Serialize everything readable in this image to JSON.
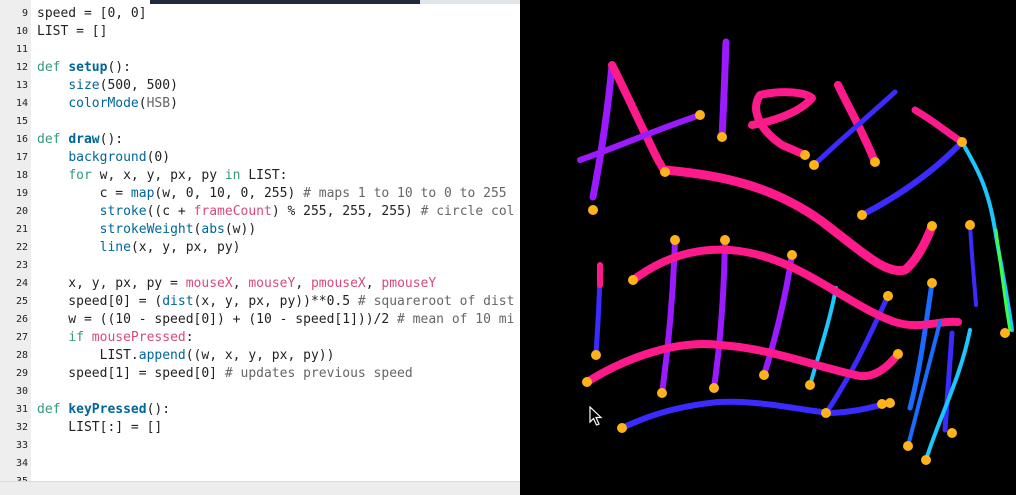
{
  "editor": {
    "lines": [
      {
        "no": "9",
        "tokens": [
          {
            "t": "speed = [0, 0]",
            "c": ""
          }
        ]
      },
      {
        "no": "10",
        "tokens": [
          {
            "t": "LIST = []",
            "c": ""
          }
        ]
      },
      {
        "no": "11",
        "tokens": []
      },
      {
        "no": "12",
        "tokens": [
          {
            "t": "def ",
            "c": "kw"
          },
          {
            "t": "setup",
            "c": "fn"
          },
          {
            "t": "():",
            "c": ""
          }
        ]
      },
      {
        "no": "13",
        "tokens": [
          {
            "t": "    ",
            "c": ""
          },
          {
            "t": "size",
            "c": "bi"
          },
          {
            "t": "(500, 500)",
            "c": ""
          }
        ]
      },
      {
        "no": "14",
        "tokens": [
          {
            "t": "    ",
            "c": ""
          },
          {
            "t": "colorMode",
            "c": "bi"
          },
          {
            "t": "(",
            "c": ""
          },
          {
            "t": "HSB",
            "c": "gy"
          },
          {
            "t": ")",
            "c": ""
          }
        ]
      },
      {
        "no": "15",
        "tokens": []
      },
      {
        "no": "16",
        "tokens": [
          {
            "t": "def ",
            "c": "kw"
          },
          {
            "t": "draw",
            "c": "fn"
          },
          {
            "t": "():",
            "c": ""
          }
        ]
      },
      {
        "no": "17",
        "tokens": [
          {
            "t": "    ",
            "c": ""
          },
          {
            "t": "background",
            "c": "bi"
          },
          {
            "t": "(0)",
            "c": ""
          }
        ]
      },
      {
        "no": "18",
        "tokens": [
          {
            "t": "    ",
            "c": ""
          },
          {
            "t": "for",
            "c": "kw"
          },
          {
            "t": " w, x, y, px, py ",
            "c": ""
          },
          {
            "t": "in",
            "c": "kw"
          },
          {
            "t": " LIST:",
            "c": ""
          }
        ]
      },
      {
        "no": "19",
        "tokens": [
          {
            "t": "        c = ",
            "c": ""
          },
          {
            "t": "map",
            "c": "bi"
          },
          {
            "t": "(w, 0, 10, 0, 255) ",
            "c": ""
          },
          {
            "t": "# maps 1 to 10 to 0 to 255",
            "c": "cm"
          }
        ]
      },
      {
        "no": "20",
        "tokens": [
          {
            "t": "        ",
            "c": ""
          },
          {
            "t": "stroke",
            "c": "bi"
          },
          {
            "t": "((c + ",
            "c": ""
          },
          {
            "t": "frameCount",
            "c": "vr"
          },
          {
            "t": ") % 255, 255, 255) ",
            "c": ""
          },
          {
            "t": "# circle col",
            "c": "cm"
          }
        ]
      },
      {
        "no": "21",
        "tokens": [
          {
            "t": "        ",
            "c": ""
          },
          {
            "t": "strokeWeight",
            "c": "bi"
          },
          {
            "t": "(",
            "c": ""
          },
          {
            "t": "abs",
            "c": "bi"
          },
          {
            "t": "(w))",
            "c": ""
          }
        ]
      },
      {
        "no": "22",
        "tokens": [
          {
            "t": "        ",
            "c": ""
          },
          {
            "t": "line",
            "c": "bi"
          },
          {
            "t": "(x, y, px, py)",
            "c": ""
          }
        ]
      },
      {
        "no": "23",
        "tokens": []
      },
      {
        "no": "24",
        "tokens": [
          {
            "t": "    x, y, px, py = ",
            "c": ""
          },
          {
            "t": "mouseX",
            "c": "vr"
          },
          {
            "t": ", ",
            "c": ""
          },
          {
            "t": "mouseY",
            "c": "vr"
          },
          {
            "t": ", ",
            "c": ""
          },
          {
            "t": "pmouseX",
            "c": "vr"
          },
          {
            "t": ", ",
            "c": ""
          },
          {
            "t": "pmouseY",
            "c": "vr"
          }
        ]
      },
      {
        "no": "25",
        "tokens": [
          {
            "t": "    speed[0] = (",
            "c": ""
          },
          {
            "t": "dist",
            "c": "bi"
          },
          {
            "t": "(x, y, px, py))**0.5 ",
            "c": ""
          },
          {
            "t": "# squareroot of dist",
            "c": "cm"
          }
        ]
      },
      {
        "no": "26",
        "tokens": [
          {
            "t": "    w = ((10 - speed[0]) + (10 - speed[1]))/2 ",
            "c": ""
          },
          {
            "t": "# mean of 10 mi",
            "c": "cm"
          }
        ]
      },
      {
        "no": "27",
        "tokens": [
          {
            "t": "    ",
            "c": ""
          },
          {
            "t": "if",
            "c": "kw"
          },
          {
            "t": " ",
            "c": ""
          },
          {
            "t": "mousePressed",
            "c": "vr"
          },
          {
            "t": ":",
            "c": ""
          }
        ]
      },
      {
        "no": "28",
        "tokens": [
          {
            "t": "        LIST.",
            "c": ""
          },
          {
            "t": "append",
            "c": "bi"
          },
          {
            "t": "((w, x, y, px, py))",
            "c": ""
          }
        ]
      },
      {
        "no": "29",
        "tokens": [
          {
            "t": "    speed[1] = speed[0] ",
            "c": ""
          },
          {
            "t": "# updates previous speed",
            "c": "cm"
          }
        ]
      },
      {
        "no": "30",
        "tokens": []
      },
      {
        "no": "31",
        "tokens": [
          {
            "t": "def ",
            "c": "kw"
          },
          {
            "t": "keyPressed",
            "c": "fn"
          },
          {
            "t": "():",
            "c": ""
          }
        ]
      },
      {
        "no": "32",
        "tokens": [
          {
            "t": "    LIST[:] = []",
            "c": ""
          }
        ]
      },
      {
        "no": "33",
        "tokens": []
      },
      {
        "no": "34",
        "tokens": []
      },
      {
        "no": "35",
        "tokens": []
      }
    ]
  },
  "canvas": {
    "background": "#000000",
    "stroke_colors": [
      "#ff1a8c",
      "#9b1aff",
      "#3b2bff",
      "#1a6bff",
      "#1ac8ff",
      "#3aff4a"
    ],
    "endpoint_color": "#ffb21a"
  },
  "cursor": {
    "icon": "mouse-pointer-icon"
  }
}
